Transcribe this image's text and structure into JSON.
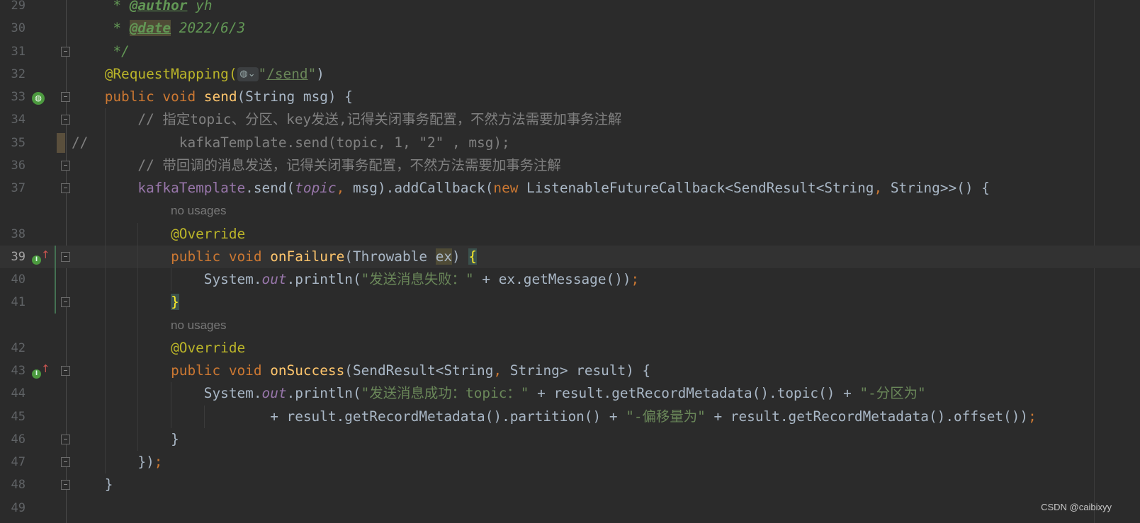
{
  "editor": {
    "colors": {
      "background": "#2b2b2b",
      "keyword": "#cc7832",
      "annotation": "#bbb529",
      "method": "#ffc66d",
      "string": "#6a8759",
      "comment": "#808080",
      "doc": "#629755",
      "field": "#9876aa",
      "text": "#a9b7c6"
    },
    "current_line": 39,
    "lines": [
      {
        "n": "29",
        "t": [
          [
            "    ",
            ""
          ],
          [
            " * ",
            "doc"
          ],
          [
            "@author",
            "doctag"
          ],
          [
            " yh",
            "doc"
          ]
        ]
      },
      {
        "n": "30",
        "t": [
          [
            "    ",
            ""
          ],
          [
            " * ",
            "doc"
          ],
          [
            "@date",
            "doctag doctagbg"
          ],
          [
            " 2022/6/3",
            "doc"
          ]
        ]
      },
      {
        "n": "31",
        "t": [
          [
            "    ",
            ""
          ],
          [
            " */",
            "doc"
          ]
        ]
      },
      {
        "n": "32",
        "t": [
          [
            "    ",
            ""
          ],
          [
            "@RequestMapping(",
            "ann"
          ],
          [
            "GLOBE",
            "globe"
          ],
          [
            "\"",
            "str"
          ],
          [
            "/send",
            "strlink"
          ],
          [
            "\"",
            "str"
          ],
          [
            ")",
            "plain"
          ]
        ]
      },
      {
        "n": "33",
        "t": [
          [
            "    ",
            ""
          ],
          [
            "public void ",
            "kw"
          ],
          [
            "send",
            "fn"
          ],
          [
            "(String msg) {",
            "plain"
          ]
        ]
      },
      {
        "n": "34",
        "t": [
          [
            "        ",
            ""
          ],
          [
            "// 指定topic、分区、key发送,记得关闭事务配置，不然方法需要加事务注解",
            "cmt"
          ]
        ]
      },
      {
        "n": "35",
        "t": [
          [
            "//           kafkaTemplate.send(topic, 1, \"2\" , msg);",
            "cmt"
          ]
        ]
      },
      {
        "n": "36",
        "t": [
          [
            "        ",
            ""
          ],
          [
            "// 带回调的消息发送，记得关闭事务配置，不然方法需要加事务注解",
            "cmt"
          ]
        ]
      },
      {
        "n": "37",
        "t": [
          [
            "        ",
            ""
          ],
          [
            "kafkaTemplate",
            "fld"
          ],
          [
            ".send(",
            "plain"
          ],
          [
            "topic",
            "sfld"
          ],
          [
            ",",
            "kw"
          ],
          [
            " msg).addCallback(",
            "plain"
          ],
          [
            "new ",
            "kw"
          ],
          [
            "ListenableFutureCallback<SendResult<String",
            "plain"
          ],
          [
            ",",
            "kw"
          ],
          [
            " String>>() {",
            "plain"
          ]
        ]
      },
      {
        "inlay": "no usages"
      },
      {
        "n": "38",
        "t": [
          [
            "            ",
            ""
          ],
          [
            "@Override",
            "ann"
          ]
        ]
      },
      {
        "n": "39",
        "t": [
          [
            "            ",
            ""
          ],
          [
            "public void ",
            "kw"
          ],
          [
            "onFailure",
            "fn"
          ],
          [
            "(Throwable ",
            "plain"
          ],
          [
            "ex",
            "plain hlvar"
          ],
          [
            ") ",
            "plain"
          ],
          [
            "{",
            "brace"
          ]
        ]
      },
      {
        "n": "40",
        "t": [
          [
            "                ",
            ""
          ],
          [
            "System.",
            "plain"
          ],
          [
            "out",
            "sfld"
          ],
          [
            ".println(",
            "plain"
          ],
          [
            "\"发送消息失败：\"",
            "str"
          ],
          [
            " + ex.getMessage())",
            "plain"
          ],
          [
            ";",
            "kw"
          ]
        ]
      },
      {
        "n": "41",
        "t": [
          [
            "            ",
            ""
          ],
          [
            "}",
            "brace"
          ]
        ]
      },
      {
        "inlay": "no usages"
      },
      {
        "n": "42",
        "t": [
          [
            "            ",
            ""
          ],
          [
            "@Override",
            "ann"
          ]
        ]
      },
      {
        "n": "43",
        "t": [
          [
            "            ",
            ""
          ],
          [
            "public void ",
            "kw"
          ],
          [
            "onSuccess",
            "fn"
          ],
          [
            "(SendResult<String",
            "plain"
          ],
          [
            ",",
            "kw"
          ],
          [
            " String> result) {",
            "plain"
          ]
        ]
      },
      {
        "n": "44",
        "t": [
          [
            "                ",
            ""
          ],
          [
            "System.",
            "plain"
          ],
          [
            "out",
            "sfld"
          ],
          [
            ".println(",
            "plain"
          ],
          [
            "\"发送消息成功：topic：\"",
            "str"
          ],
          [
            " + result.getRecordMetadata().topic() + ",
            "plain"
          ],
          [
            "\"-分区为\"",
            "str"
          ]
        ]
      },
      {
        "n": "45",
        "t": [
          [
            "                        ",
            ""
          ],
          [
            "+ result.getRecordMetadata().partition() + ",
            "plain"
          ],
          [
            "\"-偏移量为\"",
            "str"
          ],
          [
            " + result.getRecordMetadata().offset())",
            "plain"
          ],
          [
            ";",
            "kw"
          ]
        ]
      },
      {
        "n": "46",
        "t": [
          [
            "            ",
            ""
          ],
          [
            "}",
            "plain"
          ]
        ]
      },
      {
        "n": "47",
        "t": [
          [
            "        ",
            ""
          ],
          [
            "})",
            "plain"
          ],
          [
            ";",
            "kw"
          ]
        ]
      },
      {
        "n": "48",
        "t": [
          [
            "    ",
            ""
          ],
          [
            "}",
            "plain"
          ]
        ]
      },
      {
        "n": "49",
        "t": []
      }
    ],
    "gutter_icons": {
      "33": "spring-web-endpoint-icon",
      "39": "implements-method-icon",
      "43": "implements-method-icon"
    },
    "fold_lines": [
      "31",
      "33",
      "34",
      "36",
      "37",
      "39",
      "41",
      "43",
      "46",
      "47",
      "48"
    ]
  },
  "watermark": "CSDN @caibixyy"
}
